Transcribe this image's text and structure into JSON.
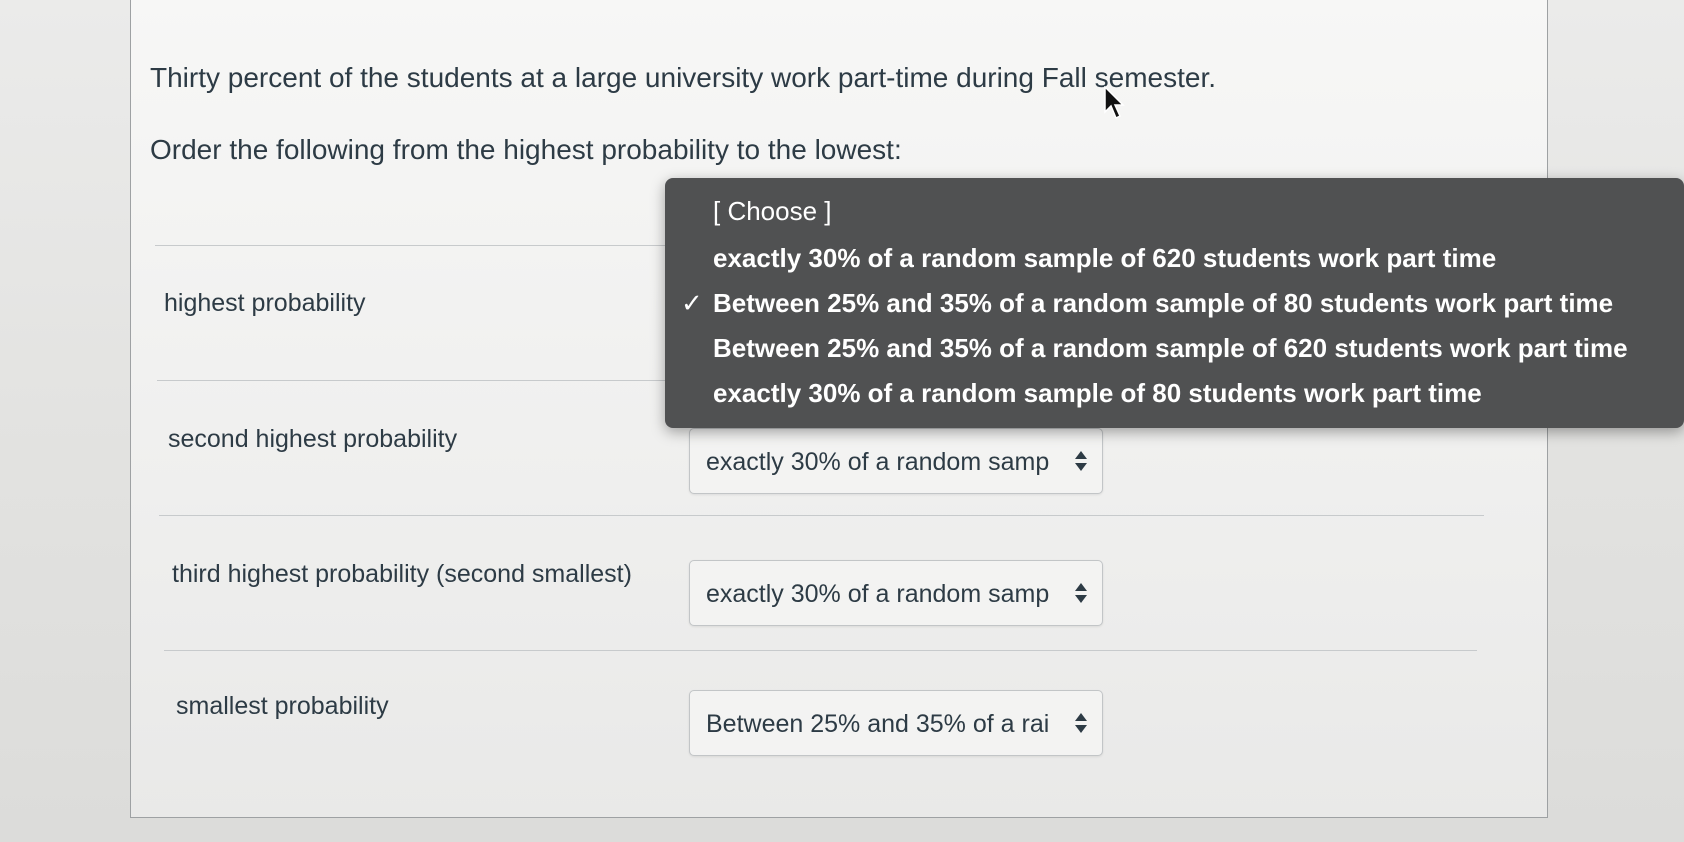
{
  "question": {
    "line1": "Thirty percent of the students at a large university work part-time during Fall semester.",
    "line2": "Order the following from the highest probability to the lowest:"
  },
  "rows": [
    {
      "label": "highest probability",
      "selected": "Between 25% and 35% of a random sample of 80 students work part time"
    },
    {
      "label": "second highest probability",
      "selected": "exactly 30% of a random samp"
    },
    {
      "label": "third highest probability (second smallest)",
      "selected": "exactly 30% of a random samp"
    },
    {
      "label": "smallest probability",
      "selected": "Between 25% and 35% of a rai"
    }
  ],
  "dropdown": {
    "options": [
      "[ Choose ]",
      "exactly 30% of a random sample of 620 students work part time",
      "Between 25% and 35% of a random sample of 80 students work part time",
      "Between 25% and 35% of a random sample of 620 students work part time",
      "exactly 30% of a random sample of 80 students work part time"
    ],
    "selected_index": 2,
    "check_glyph": "✓"
  },
  "colors": {
    "text": "#2d3b45",
    "dropdown_bg": "#505152",
    "dropdown_text": "#ffffff",
    "card_border": "#9ea1a3"
  }
}
